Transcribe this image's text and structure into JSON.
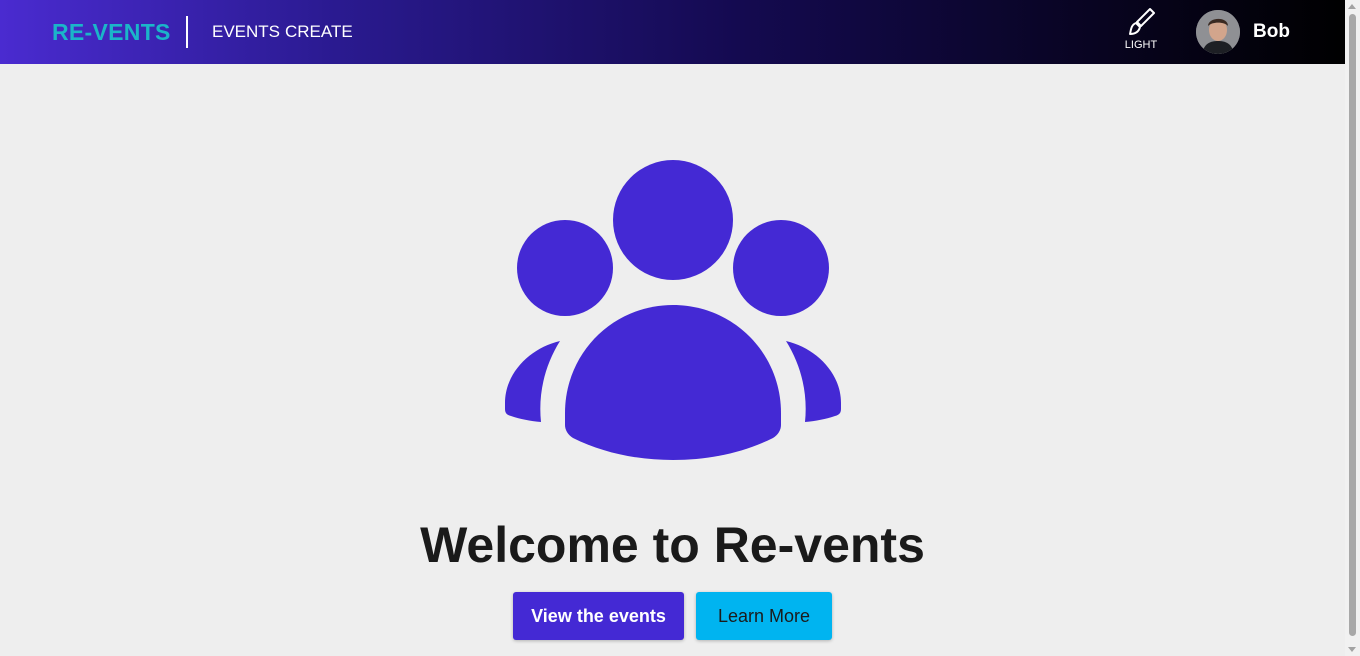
{
  "navbar": {
    "brand": "RE-VENTS",
    "links": [
      {
        "label": "EVENTS"
      },
      {
        "label": "CREATE"
      }
    ],
    "theme_toggle": {
      "label": "LIGHT",
      "icon": "paintbrush-icon"
    },
    "user": {
      "name": "Bob",
      "avatar": "user-avatar"
    }
  },
  "hero": {
    "icon": "users-group-icon",
    "title": "Welcome to Re-vents",
    "buttons": {
      "primary": "View the events",
      "secondary": "Learn More"
    }
  },
  "colors": {
    "accent": "#4429d4",
    "brand": "#1bb5c9",
    "secondary_button": "#00b4f0",
    "background": "#eeeeee"
  }
}
